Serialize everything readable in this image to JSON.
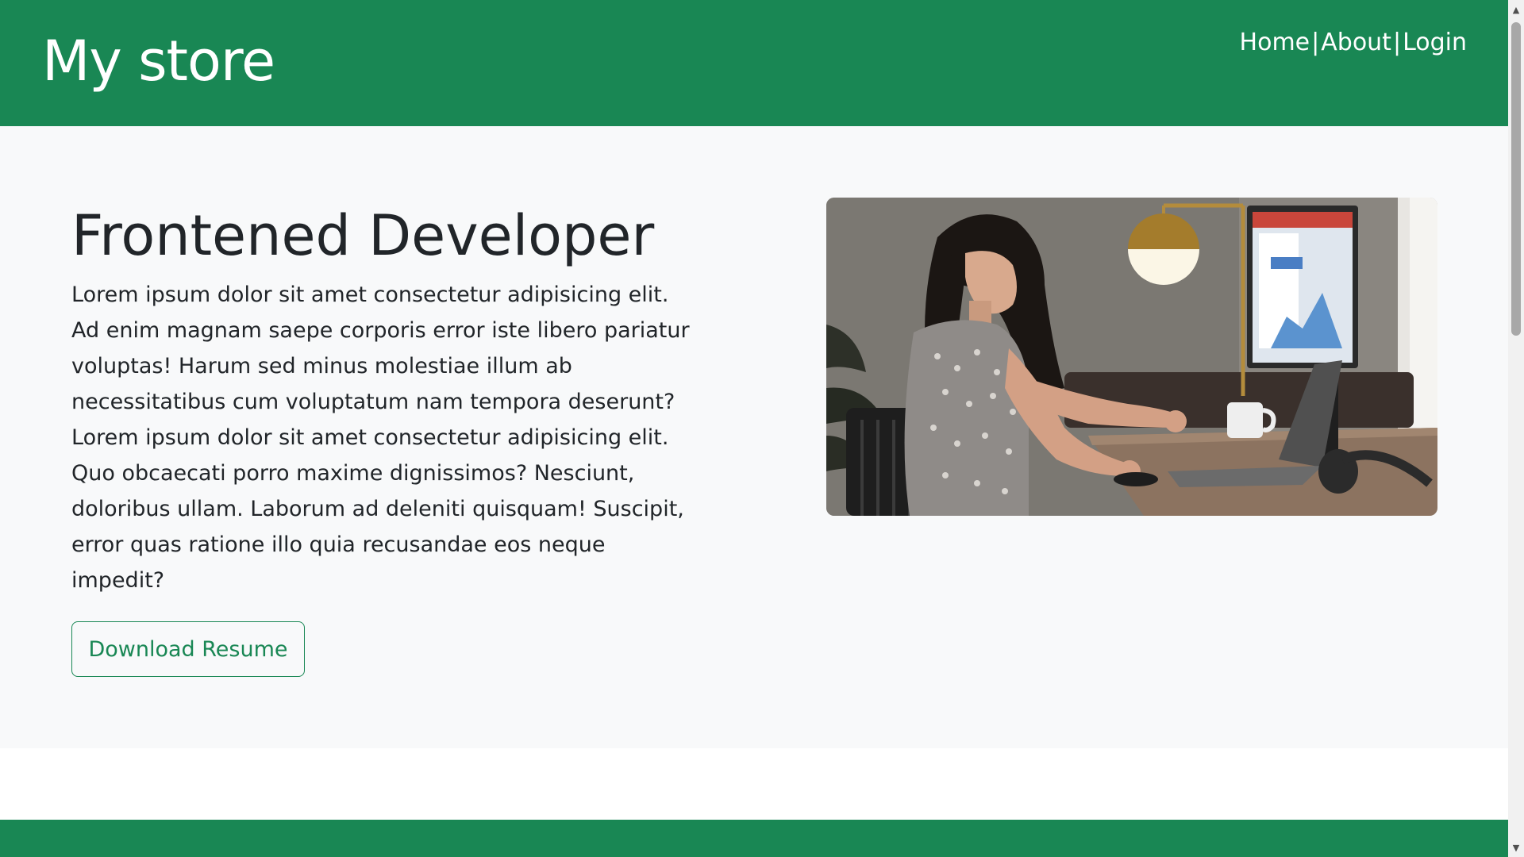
{
  "header": {
    "brand": "My store",
    "nav": {
      "home": "Home",
      "about": "About",
      "login": "Login",
      "separator": "|"
    }
  },
  "hero": {
    "title": "Frontened Developer",
    "body": "Lorem ipsum dolor sit amet consectetur adipisicing elit. Ad enim magnam saepe corporis error iste libero pariatur voluptas! Harum sed minus molestiae illum ab necessitatibus cum voluptatum nam tempora deserunt? Lorem ipsum dolor sit amet consectetur adipisicing elit. Quo obcaecati porro maxime dignissimos? Nesciunt, doloribus ullam. Laborum ad deleniti quisquam! Suscipit, error quas ratione illo quia recusandae eos neque impedit?",
    "button_label": "Download Resume",
    "image_subject": "woman-working-at-laptop-illustration"
  },
  "scrollbar": {
    "up_icon": "triangle-up-icon",
    "down_icon": "triangle-down-icon"
  },
  "colors": {
    "brand": "#198754",
    "hero_bg": "#f8f9fa",
    "text": "#212529"
  }
}
